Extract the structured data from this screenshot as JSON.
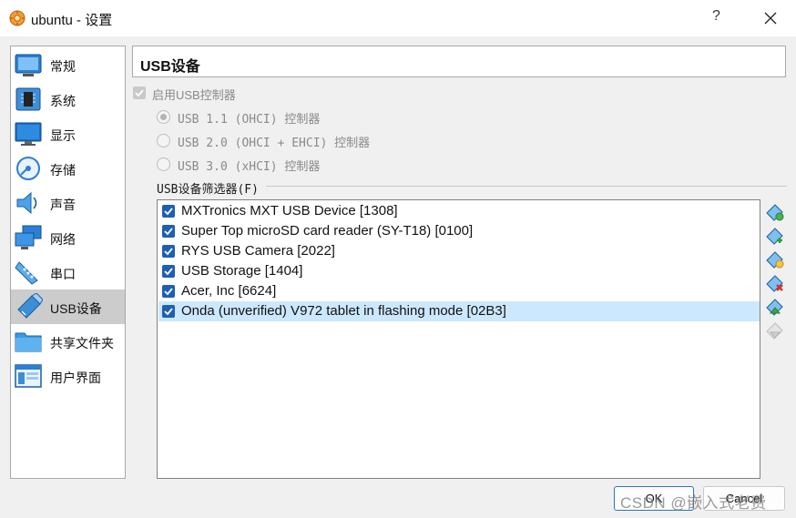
{
  "window": {
    "title": "ubuntu - 设置",
    "help_label": "?",
    "icon_name": "virtualbox-gear-icon"
  },
  "sidebar": {
    "items": [
      {
        "label": "常规",
        "icon": "general-icon"
      },
      {
        "label": "系统",
        "icon": "system-chip-icon"
      },
      {
        "label": "显示",
        "icon": "display-monitor-icon"
      },
      {
        "label": "存储",
        "icon": "storage-disc-icon"
      },
      {
        "label": "声音",
        "icon": "audio-speaker-icon"
      },
      {
        "label": "网络",
        "icon": "network-icon"
      },
      {
        "label": "串口",
        "icon": "serial-port-icon"
      },
      {
        "label": "USB设备",
        "icon": "usb-icon"
      },
      {
        "label": "共享文件夹",
        "icon": "shared-folder-icon"
      },
      {
        "label": "用户界面",
        "icon": "user-interface-icon"
      }
    ],
    "active_index": 7
  },
  "main": {
    "heading": "USB设备",
    "enable_usb_label": "启用USB控制器",
    "enable_usb_checked": true,
    "controllers": [
      {
        "label": "USB 1.1 (OHCI) 控制器",
        "selected": true
      },
      {
        "label": "USB 2.0 (OHCI + EHCI) 控制器",
        "selected": false
      },
      {
        "label": "USB 3.0 (xHCI) 控制器",
        "selected": false
      }
    ],
    "filters_label": "USB设备筛选器(F)",
    "filters": [
      {
        "label": "MXTronics MXT USB Device [1308]",
        "checked": true
      },
      {
        "label": "Super Top microSD card reader (SY-T18) [0100]",
        "checked": true
      },
      {
        "label": "RYS USB Camera [2022]",
        "checked": true
      },
      {
        "label": "USB Storage [1404]",
        "checked": true
      },
      {
        "label": "Acer, Inc  [6624]",
        "checked": true
      },
      {
        "label": "Onda (unverified) V972 tablet in flashing mode [02B3]",
        "checked": true
      }
    ],
    "selected_filter_index": 5,
    "toolbar": [
      "add-empty-filter-icon",
      "add-filter-from-device-icon",
      "edit-filter-icon",
      "remove-filter-icon",
      "move-filter-up-icon",
      "move-filter-down-icon"
    ]
  },
  "buttons": {
    "ok": "OK",
    "cancel": "Cancel"
  },
  "watermark": "CSDN @嵌入式老费",
  "colors": {
    "accent": "#1e5fb4",
    "selection": "#cce8ff",
    "sidebar_active": "#cccccc",
    "usb_icon_blue": "#3b8fd6"
  }
}
